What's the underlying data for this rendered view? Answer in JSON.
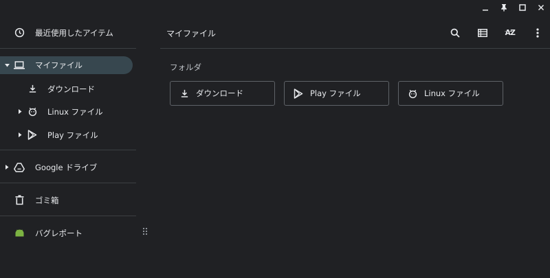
{
  "window": {
    "minimize_icon": "minimize-icon",
    "pin_icon": "pin-icon",
    "maximize_icon": "maximize-icon",
    "close_icon": "close-icon"
  },
  "sidebar": {
    "recent": "最近使用したアイテム",
    "my_files": "マイファイル",
    "downloads": "ダウンロード",
    "linux_files": "Linux ファイル",
    "play_files": "Play ファイル",
    "google_drive": "Google ドライブ",
    "trash": "ゴミ箱",
    "bug_report": "バグレポート"
  },
  "main": {
    "title": "マイファイル",
    "section_folders": "フォルダ",
    "folders": [
      {
        "label": "ダウンロード",
        "icon": "download-icon"
      },
      {
        "label": "Play ファイル",
        "icon": "play-icon"
      },
      {
        "label": "Linux ファイル",
        "icon": "linux-icon"
      }
    ],
    "sort_label": "AZ"
  },
  "colors": {
    "background": "#202124",
    "selected": "#37474f",
    "divider": "#3c4043",
    "text": "#e8eaed",
    "bug_icon": "#7cb342"
  }
}
